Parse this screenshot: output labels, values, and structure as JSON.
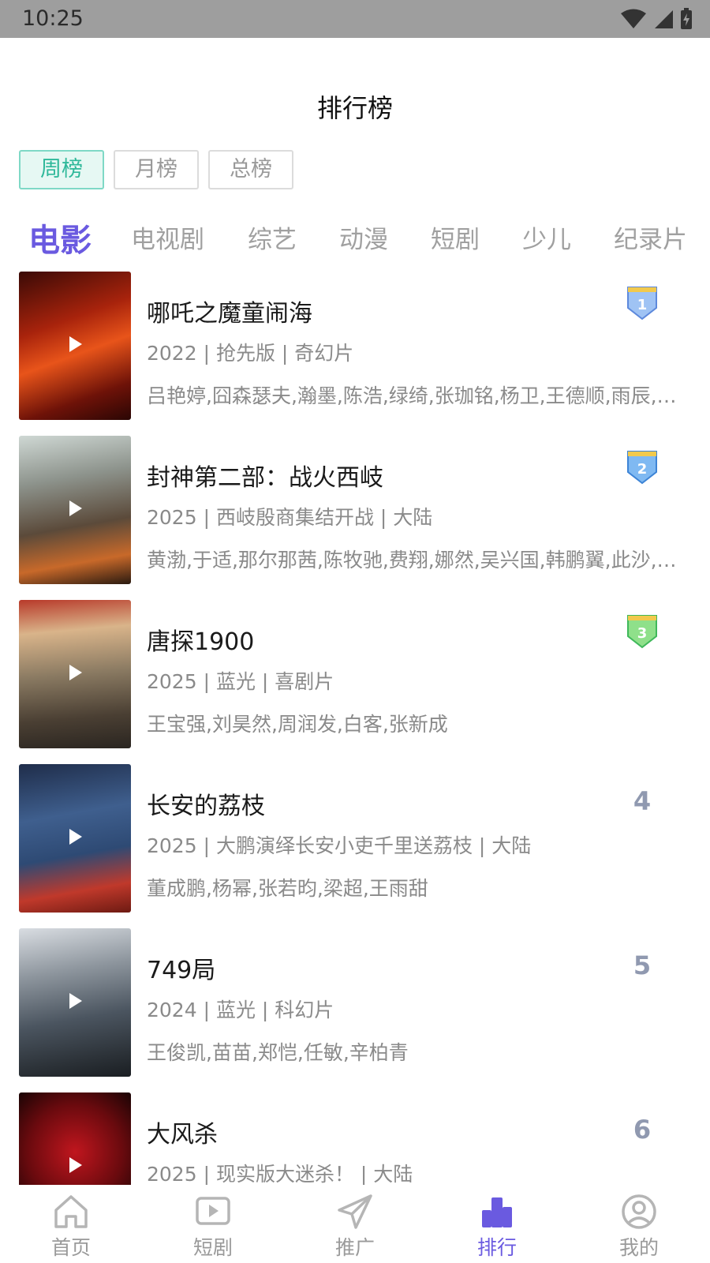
{
  "status_bar": {
    "time": "10:25"
  },
  "header": {
    "title": "排行榜"
  },
  "period_tabs": [
    {
      "label": "周榜",
      "active": true
    },
    {
      "label": "月榜",
      "active": false
    },
    {
      "label": "总榜",
      "active": false
    }
  ],
  "category_tabs": [
    {
      "label": "电影",
      "active": true
    },
    {
      "label": "电视剧",
      "active": false
    },
    {
      "label": "综艺",
      "active": false
    },
    {
      "label": "动漫",
      "active": false
    },
    {
      "label": "短剧",
      "active": false
    },
    {
      "label": "少儿",
      "active": false
    },
    {
      "label": "纪录片",
      "active": false
    }
  ],
  "rankings": [
    {
      "rank": "1",
      "title": "哪吒之魔童闹海",
      "info": "2022 | 抢先版 | 奇幻片",
      "cast": "吕艳婷,囧森瑟夫,瀚墨,陈浩,绿绮,张珈铭,杨卫,王德顺,雨辰,周野芒",
      "badge": "blue"
    },
    {
      "rank": "2",
      "title": "封神第二部：战火西岐",
      "info": "2025 | 西岐殷商集结开战 | 大陆",
      "cast": "黄渤,于适,那尔那茜,陈牧驰,费翔,娜然,吴兴国,韩鹏翼,此沙,李雪健",
      "badge": "blue"
    },
    {
      "rank": "3",
      "title": "唐探1900",
      "info": "2025 | 蓝光 | 喜剧片",
      "cast": "王宝强,刘昊然,周润发,白客,张新成",
      "badge": "green"
    },
    {
      "rank": "4",
      "title": "长安的荔枝",
      "info": "2025 | 大鹏演绎长安小吏千里送荔枝 | 大陆",
      "cast": "董成鹏,杨幂,张若昀,梁超,王雨甜",
      "badge": "number"
    },
    {
      "rank": "5",
      "title": "749局",
      "info": "2024 | 蓝光 | 科幻片",
      "cast": "王俊凯,苗苗,郑恺,任敏,辛柏青",
      "badge": "number"
    },
    {
      "rank": "6",
      "title": "大风杀",
      "info": "2025 | 现实版大迷杀！ | 大陆",
      "cast": "",
      "badge": "number"
    }
  ],
  "bottom_nav": [
    {
      "label": "首页",
      "icon": "home-icon",
      "active": false
    },
    {
      "label": "短剧",
      "icon": "play-box-icon",
      "active": false
    },
    {
      "label": "推广",
      "icon": "paper-plane-icon",
      "active": false
    },
    {
      "label": "排行",
      "icon": "ranking-bars-icon",
      "active": true
    },
    {
      "label": "我的",
      "icon": "user-circle-icon",
      "active": false
    }
  ],
  "colors": {
    "accent": "#6a5ae0",
    "period_active": "#2fb89a",
    "rank_number": "#9099b0"
  }
}
